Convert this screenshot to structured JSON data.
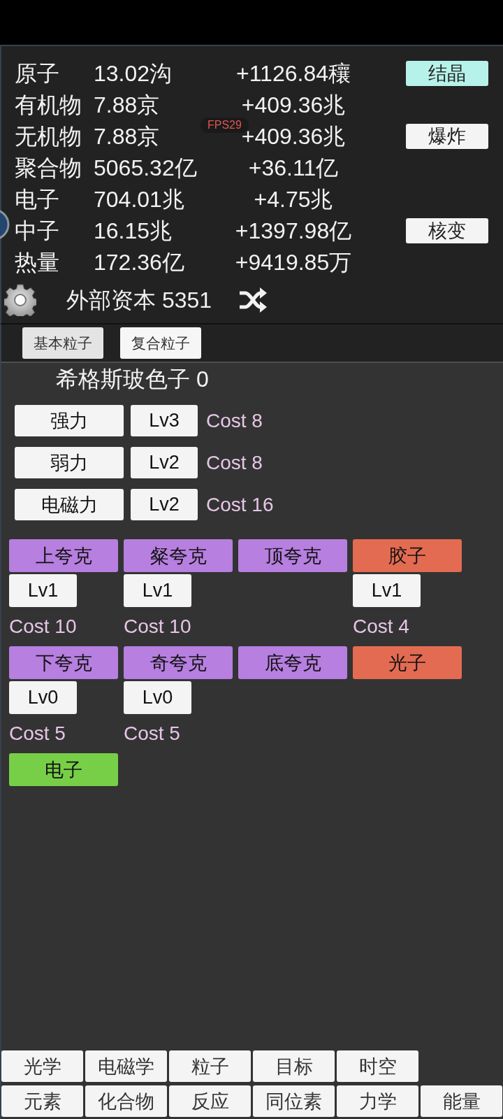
{
  "fps_badge": "FPS29",
  "resources": [
    {
      "name": "原子",
      "value": "13.02沟",
      "rate": "+1126.84穰",
      "button": {
        "label": "结晶",
        "highlighted": true
      }
    },
    {
      "name": "有机物",
      "value": "7.88京",
      "rate": "+409.36兆"
    },
    {
      "name": "无机物",
      "value": "7.88京",
      "rate": "+409.36兆",
      "button": {
        "label": "爆炸",
        "highlighted": false
      }
    },
    {
      "name": "聚合物",
      "value": "5065.32亿",
      "rate": "+36.11亿"
    },
    {
      "name": "电子",
      "value": "704.01兆",
      "rate": "+4.75兆"
    },
    {
      "name": "中子",
      "value": "16.15兆",
      "rate": "+1397.98亿",
      "button": {
        "label": "核变",
        "highlighted": false
      }
    },
    {
      "name": "热量",
      "value": "172.36亿",
      "rate": "+9419.85万"
    }
  ],
  "external_capital": "外部资本 5351",
  "category_tabs": [
    {
      "label": "基本粒子",
      "selected": true
    },
    {
      "label": "复合粒子",
      "selected": false
    }
  ],
  "higgs": "希格斯玻色子 0",
  "forces": [
    {
      "name": "强力",
      "lv": "Lv3",
      "cost": "Cost 8"
    },
    {
      "name": "弱力",
      "lv": "Lv2",
      "cost": "Cost 8"
    },
    {
      "name": "电磁力",
      "lv": "Lv2",
      "cost": "Cost 16"
    }
  ],
  "particles": [
    {
      "name": "上夸克",
      "color": "#b77fe0",
      "lv": "Lv1",
      "cost": "Cost 10"
    },
    {
      "name": "粲夸克",
      "color": "#b77fe0",
      "lv": "Lv1",
      "cost": "Cost 10"
    },
    {
      "name": "顶夸克",
      "color": "#b77fe0"
    },
    {
      "name": "胶子",
      "color": "#e36b52",
      "lv": "Lv1",
      "cost": "Cost 4"
    },
    {
      "name": "下夸克",
      "color": "#b77fe0",
      "lv": "Lv0",
      "cost": "Cost 5"
    },
    {
      "name": "奇夸克",
      "color": "#b77fe0",
      "lv": "Lv0",
      "cost": "Cost 5"
    },
    {
      "name": "底夸克",
      "color": "#b77fe0"
    },
    {
      "name": "光子",
      "color": "#e36b52"
    },
    {
      "name": "电子",
      "color": "#77cf47"
    }
  ],
  "bottom_nav": [
    [
      "光学",
      "电磁学",
      "粒子",
      "目标",
      "时空"
    ],
    [
      "元素",
      "化合物",
      "反应",
      "同位素",
      "力学",
      "能量"
    ]
  ]
}
